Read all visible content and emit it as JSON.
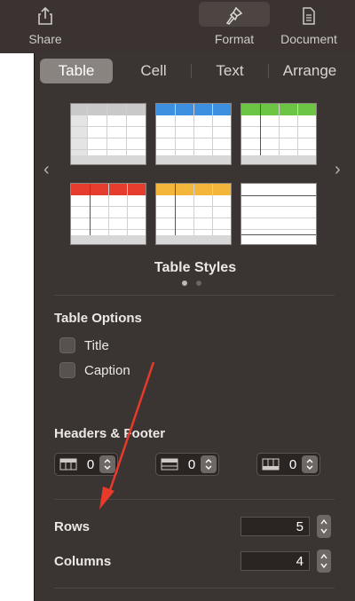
{
  "toolbar": {
    "share_label": "Share",
    "share_icon": "share-icon",
    "format_label": "Format",
    "format_icon": "paintbrush-icon",
    "document_label": "Document",
    "document_icon": "document-icon"
  },
  "tabs": [
    {
      "label": "Table",
      "active": true
    },
    {
      "label": "Cell",
      "active": false
    },
    {
      "label": "Text",
      "active": false
    },
    {
      "label": "Arrange",
      "active": false
    }
  ],
  "table_styles": {
    "title": "Table Styles",
    "page_count": 2,
    "current_page": 1,
    "thumbnails": [
      {
        "header_color": "#c9c9c9",
        "variant": "gray-header-column"
      },
      {
        "header_color": "#3d8fe0",
        "variant": "blue"
      },
      {
        "header_color": "#6cc644",
        "variant": "green"
      },
      {
        "header_color": "#e53d2e",
        "variant": "red"
      },
      {
        "header_color": "#f2b63a",
        "variant": "yellow"
      },
      {
        "header_color": "#ffffff",
        "variant": "plain"
      }
    ]
  },
  "table_options": {
    "title": "Table Options",
    "title_checkbox_label": "Title",
    "caption_checkbox_label": "Caption"
  },
  "headers_footer": {
    "title": "Headers & Footer",
    "header_rows": "0",
    "header_columns": "0",
    "footer_rows": "0"
  },
  "rows": {
    "label": "Rows",
    "value": "5"
  },
  "columns": {
    "label": "Columns",
    "value": "4"
  },
  "colors": {
    "panel_bg": "#3a3432",
    "active_tab": "#8a8481",
    "annotation_arrow": "#e8392b"
  }
}
